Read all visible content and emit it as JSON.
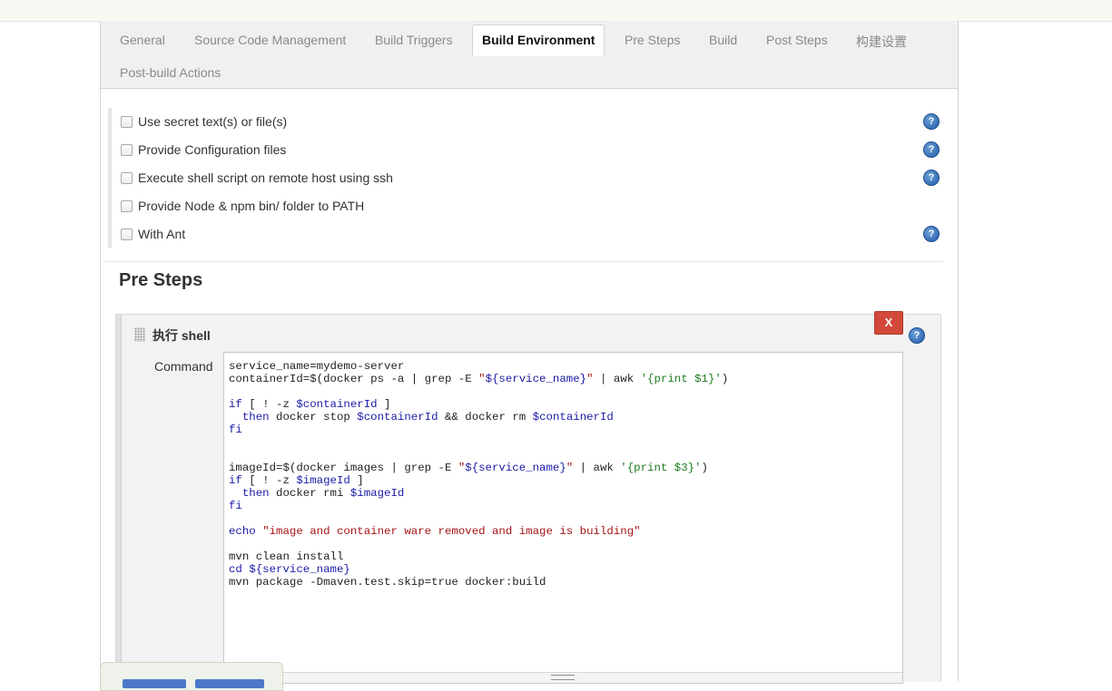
{
  "tabs": [
    {
      "label": "General"
    },
    {
      "label": "Source Code Management"
    },
    {
      "label": "Build Triggers"
    },
    {
      "label": "Build Environment"
    },
    {
      "label": "Pre Steps"
    },
    {
      "label": "Build"
    },
    {
      "label": "Post Steps"
    },
    {
      "label": "构建设置"
    },
    {
      "label": "Post-build Actions"
    }
  ],
  "active_tab": "Build Environment",
  "build_environment": {
    "options": [
      {
        "label": "Use secret text(s) or file(s)",
        "checked": false,
        "has_help": true
      },
      {
        "label": "Provide Configuration files",
        "checked": false,
        "has_help": true
      },
      {
        "label": "Execute shell script on remote host using ssh",
        "checked": false,
        "has_help": true
      },
      {
        "label": "Provide Node & npm bin/ folder to PATH",
        "checked": false,
        "has_help": false
      },
      {
        "label": "With Ant",
        "checked": false,
        "has_help": true
      }
    ]
  },
  "pre_steps": {
    "title": "Pre Steps",
    "builder": {
      "title": "执行 shell",
      "delete_label": "X",
      "command_label": "Command",
      "command_lines": [
        "service_name=mydemo-server",
        "containerId=$(docker ps -a | grep -E \"${service_name}\" | awk '{print $1}')",
        "",
        "if [ ! -z $containerId ]",
        "  then docker stop $containerId && docker rm $containerId",
        "fi",
        "",
        "",
        "imageId=$(docker images | grep -E \"${service_name}\" | awk '{print $3}')",
        "if [ ! -z $imageId ]",
        "  then docker rmi $imageId",
        "fi",
        "",
        "echo \"image and container ware removed and image is building\"",
        "",
        "mvn clean install",
        "cd ${service_name}",
        "mvn package -Dmaven.test.skip=true docker:build"
      ]
    }
  },
  "icons": {
    "help": "help-icon",
    "drag": "drag-handle-icon"
  },
  "help_glyph": "?",
  "colors": {
    "delete_button": "#d24939",
    "help_icon": "#1f5ca8",
    "tabbar_bg": "#f0f0f0"
  }
}
